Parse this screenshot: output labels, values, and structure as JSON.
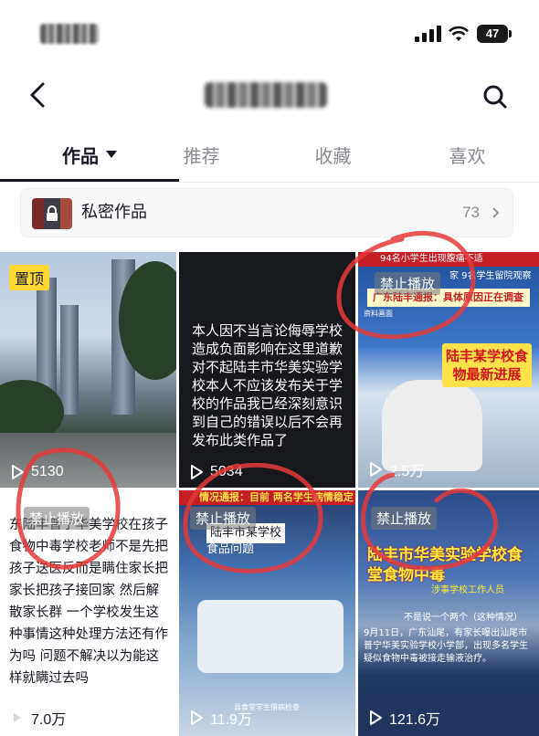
{
  "status_bar": {
    "battery_level": "47"
  },
  "nav": {
    "back_icon": "chevron-left-icon",
    "search_icon": "search-icon"
  },
  "tabs": [
    {
      "label": "作品",
      "active": true
    },
    {
      "label": "推荐",
      "active": false
    },
    {
      "label": "收藏",
      "active": false
    },
    {
      "label": "喜欢",
      "active": false
    }
  ],
  "private_row": {
    "label": "私密作品",
    "count": "73",
    "icon": "lock-icon"
  },
  "videos": [
    {
      "pinned_label": "置顶",
      "views": "5130"
    },
    {
      "caption": "本人因不当言论侮辱学校造成负面影响在这里道歉对不起陆丰市华美实验学校本人不应该发布关于学校的作品我已经深刻意识到自己的错误以后不会再发布此类作品了",
      "views": "5034"
    },
    {
      "banner_top": "94名小学生出现腹痛不适",
      "banner_mid": "家 9名学生留院观察",
      "report": "广东陆丰通报：具体原因正在调查",
      "source": "资料画面",
      "headline": "陆丰某学校食物最新进展",
      "ban_label": "禁止播放",
      "views": "2.5万"
    },
    {
      "ban_label": "禁止播放",
      "text": "东陆丰普宁华美学校在孩子食物中毒学校老师不是先把孩子送医反而是瞒住家长把家长把孩子接回家 然后解散家长群 一个学校发生这种事情这种处理方法还有作为吗 问题不解决以为能这样就瞒过去吗",
      "views": "7.0万"
    },
    {
      "ban_label": "禁止播放",
      "top_banner": "情况通报：目前 两名学生病情稳定",
      "sub1": "陆丰市某学校",
      "sub2": "食品问题",
      "footer": "县食堂学生借病检查",
      "views": "11.9万"
    },
    {
      "ban_label": "禁止播放",
      "headline": "陆丰市华美实验学校食堂食物中毒",
      "person": "涉事学校工作人员",
      "note": "不是说一个两个（这种情况）",
      "body": "9月11日，广东汕尾，有家长曝出汕尾市普宁华美实验学校小学部，出现多名学生疑似食物中毒被接走输液治疗。",
      "views": "121.6万"
    }
  ],
  "colors": {
    "text_primary": "#161823",
    "text_secondary": "#8a8b91",
    "annotation_red": "#e5393b",
    "pin_yellow": "#fdd835"
  }
}
